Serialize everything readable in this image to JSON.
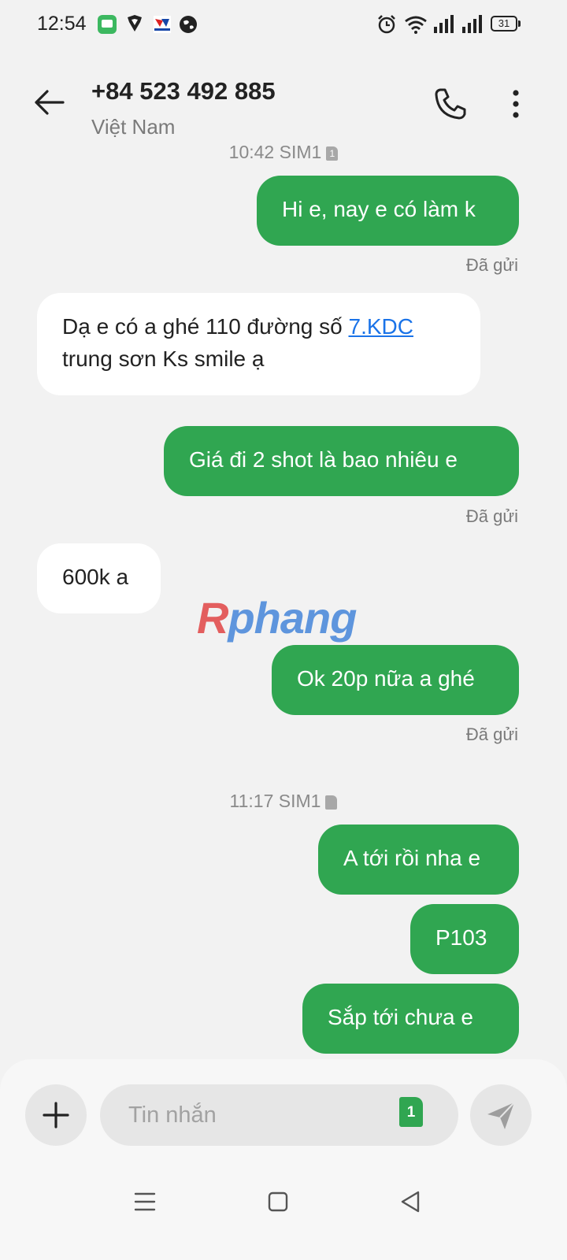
{
  "status_bar": {
    "time": "12:54",
    "battery": "31",
    "left_icons": [
      "messages-app-icon",
      "vpn-shield-icon",
      "app-logo-icon",
      "globe-icon"
    ],
    "right_icons": [
      "alarm-icon",
      "wifi-icon",
      "signal-icon",
      "signal-icon",
      "battery-icon"
    ]
  },
  "header": {
    "contact_name": "+84 523 492 885",
    "contact_sub": "Việt Nam"
  },
  "conversation": {
    "timestamp_1": "10:42 SIM1",
    "timestamp_1_sim": "1",
    "timestamp_2": "11:17 SIM1",
    "messages": [
      {
        "direction": "outgoing",
        "text": "Hi e, nay e có làm k",
        "status": "Đã gửi"
      },
      {
        "direction": "incoming",
        "text_before_link": "Dạ e có a ghé 110 đường số ",
        "link": "7.KDC",
        "text_after_link": "trung sơn Ks smile ạ"
      },
      {
        "direction": "outgoing",
        "text": "Giá đi 2 shot là bao nhiêu e",
        "status": "Đã gửi"
      },
      {
        "direction": "incoming",
        "text": "600k a"
      },
      {
        "direction": "outgoing",
        "text": "Ok 20p nữa a ghé",
        "status": "Đã gửi"
      },
      {
        "direction": "outgoing",
        "text": "A tới rồi nha e"
      },
      {
        "direction": "outgoing",
        "text": "P103"
      },
      {
        "direction": "outgoing",
        "text": "Sắp tới chưa e"
      }
    ]
  },
  "watermark": {
    "first": "R",
    "rest": "phang"
  },
  "composer": {
    "placeholder": "Tin nhắn",
    "sim_badge": "1"
  },
  "colors": {
    "outgoing_bubble": "#30a651",
    "incoming_bubble": "#ffffff",
    "background": "#f2f2f2",
    "link": "#1a73e8"
  }
}
